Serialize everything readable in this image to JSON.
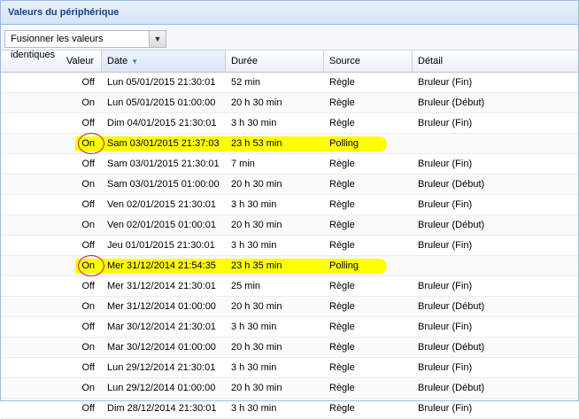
{
  "panel": {
    "title": "Valeurs du périphérique"
  },
  "toolbar": {
    "combo_value": "Fusionner les valeurs identiques"
  },
  "columns": [
    "Valeur",
    "Date",
    "Durée",
    "Source",
    "Détail"
  ],
  "rows": [
    {
      "valeur": "Off",
      "date": "Lun 05/01/2015 21:30:01",
      "duree": "52 min",
      "source": "Règle",
      "detail": "Bruleur (Fin)"
    },
    {
      "valeur": "On",
      "date": "Lun 05/01/2015 01:00:00",
      "duree": "20 h 30 min",
      "source": "Règle",
      "detail": "Bruleur (Début)"
    },
    {
      "valeur": "Off",
      "date": "Dim 04/01/2015 21:30:01",
      "duree": "3 h 30 min",
      "source": "Règle",
      "detail": "Bruleur (Fin)"
    },
    {
      "valeur": "On",
      "date": "Sam 03/01/2015 21:37:03",
      "duree": "23 h 53 min",
      "source": "Polling",
      "detail": "",
      "highlighted": true
    },
    {
      "valeur": "Off",
      "date": "Sam 03/01/2015 21:30:01",
      "duree": "7 min",
      "source": "Règle",
      "detail": "Bruleur (Fin)"
    },
    {
      "valeur": "On",
      "date": "Sam 03/01/2015 01:00:00",
      "duree": "20 h 30 min",
      "source": "Règle",
      "detail": "Bruleur (Début)"
    },
    {
      "valeur": "Off",
      "date": "Ven 02/01/2015 21:30:01",
      "duree": "3 h 30 min",
      "source": "Règle",
      "detail": "Bruleur (Fin)"
    },
    {
      "valeur": "On",
      "date": "Ven 02/01/2015 01:00:01",
      "duree": "20 h 30 min",
      "source": "Règle",
      "detail": "Bruleur (Début)"
    },
    {
      "valeur": "Off",
      "date": "Jeu 01/01/2015 21:30:01",
      "duree": "3 h 30 min",
      "source": "Règle",
      "detail": "Bruleur (Fin)"
    },
    {
      "valeur": "On",
      "date": "Mer 31/12/2014 21:54:35",
      "duree": "23 h 35 min",
      "source": "Polling",
      "detail": "",
      "highlighted": true
    },
    {
      "valeur": "Off",
      "date": "Mer 31/12/2014 21:30:01",
      "duree": "25 min",
      "source": "Règle",
      "detail": "Bruleur (Fin)"
    },
    {
      "valeur": "On",
      "date": "Mer 31/12/2014 01:00:00",
      "duree": "20 h 30 min",
      "source": "Règle",
      "detail": "Bruleur (Début)"
    },
    {
      "valeur": "Off",
      "date": "Mar 30/12/2014 21:30:01",
      "duree": "3 h 30 min",
      "source": "Règle",
      "detail": "Bruleur (Fin)"
    },
    {
      "valeur": "On",
      "date": "Mar 30/12/2014 01:00:00",
      "duree": "20 h 30 min",
      "source": "Règle",
      "detail": "Bruleur (Début)"
    },
    {
      "valeur": "Off",
      "date": "Lun 29/12/2014 21:30:01",
      "duree": "3 h 30 min",
      "source": "Règle",
      "detail": "Bruleur (Fin)"
    },
    {
      "valeur": "On",
      "date": "Lun 29/12/2014 01:00:00",
      "duree": "20 h 30 min",
      "source": "Règle",
      "detail": "Bruleur (Début)"
    },
    {
      "valeur": "Off",
      "date": "Dim 28/12/2014 21:30:01",
      "duree": "3 h 30 min",
      "source": "Règle",
      "detail": "Bruleur (Fin)"
    }
  ],
  "colors": {
    "highlight": "#ffff00",
    "annotation_circle": "#d21b1b",
    "title_text": "#15428b"
  }
}
